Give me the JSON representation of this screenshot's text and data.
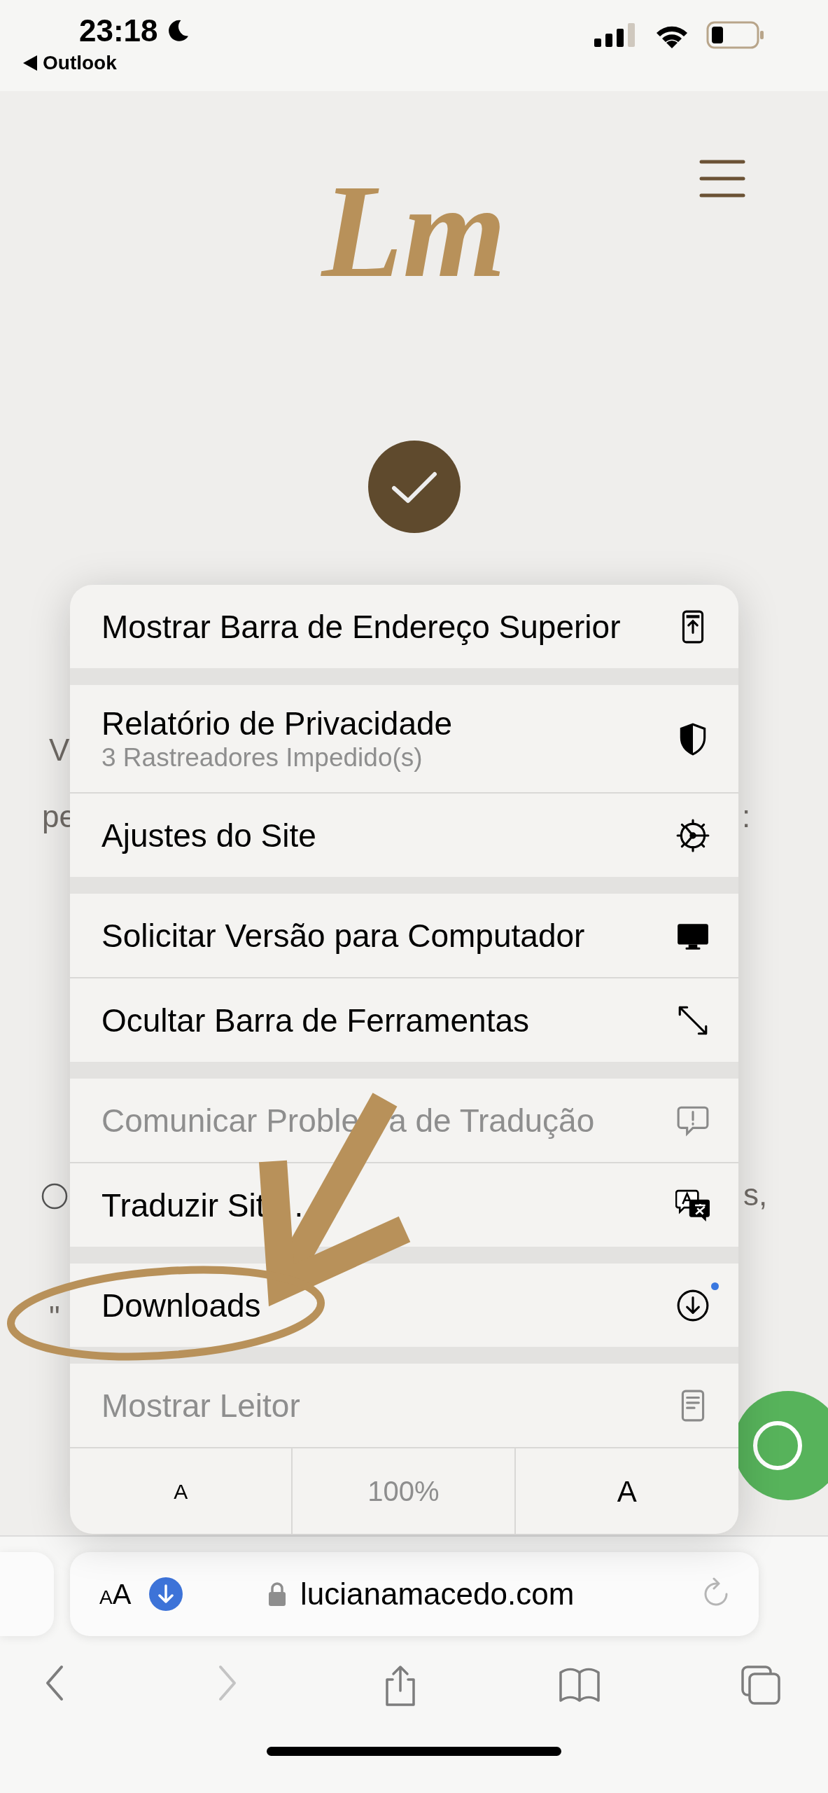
{
  "status_bar": {
    "time": "23:18",
    "back_app": "Outlook"
  },
  "page": {
    "logo_text": "Lm",
    "fragments": [
      {
        "kind": "text",
        "text": "V"
      },
      {
        "kind": "text",
        "text": "pe"
      },
      {
        "kind": "text",
        "text": ":"
      },
      {
        "kind": "radio"
      },
      {
        "kind": "text",
        "text": "s,"
      },
      {
        "kind": "text",
        "text": "\""
      }
    ]
  },
  "menu": {
    "groups": [
      {
        "items": [
          {
            "label": "Mostrar Barra de Endereço Superior",
            "disabled": false,
            "badge": false
          }
        ]
      },
      {
        "items": [
          {
            "label": "Relatório de Privacidade",
            "subtitle": "3 Rastreadores Impedido(s)",
            "disabled": false,
            "badge": false
          },
          {
            "label": "Ajustes do Site",
            "disabled": false,
            "badge": false
          }
        ]
      },
      {
        "items": [
          {
            "label": "Solicitar Versão para Computador",
            "disabled": false,
            "badge": false
          },
          {
            "label": "Ocultar Barra de Ferramentas",
            "disabled": false,
            "badge": false
          }
        ]
      },
      {
        "items": [
          {
            "label": "Comunicar Proble",
            "label_tail": "a de Tradução",
            "disabled": true,
            "badge": false
          },
          {
            "label": "Traduzir Sit",
            "label_tail": ".",
            "disabled": false,
            "badge": false
          }
        ]
      },
      {
        "items": [
          {
            "label": "Downloads",
            "disabled": false,
            "badge": true
          }
        ]
      },
      {
        "items": [
          {
            "label": "Mostrar Leitor",
            "disabled": true,
            "badge": false
          }
        ]
      }
    ],
    "zoom_row": {
      "smaller": "A",
      "level": "100%",
      "larger": "A"
    }
  },
  "address_bar": {
    "text_small": "A",
    "text_large": "A",
    "download_badge": true,
    "url": "lucianamacedo.com"
  },
  "toolbar": {
    "buttons": [
      {
        "disabled": false
      },
      {
        "disabled": true
      },
      {
        "disabled": false
      },
      {
        "disabled": false
      },
      {
        "disabled": false
      }
    ]
  }
}
